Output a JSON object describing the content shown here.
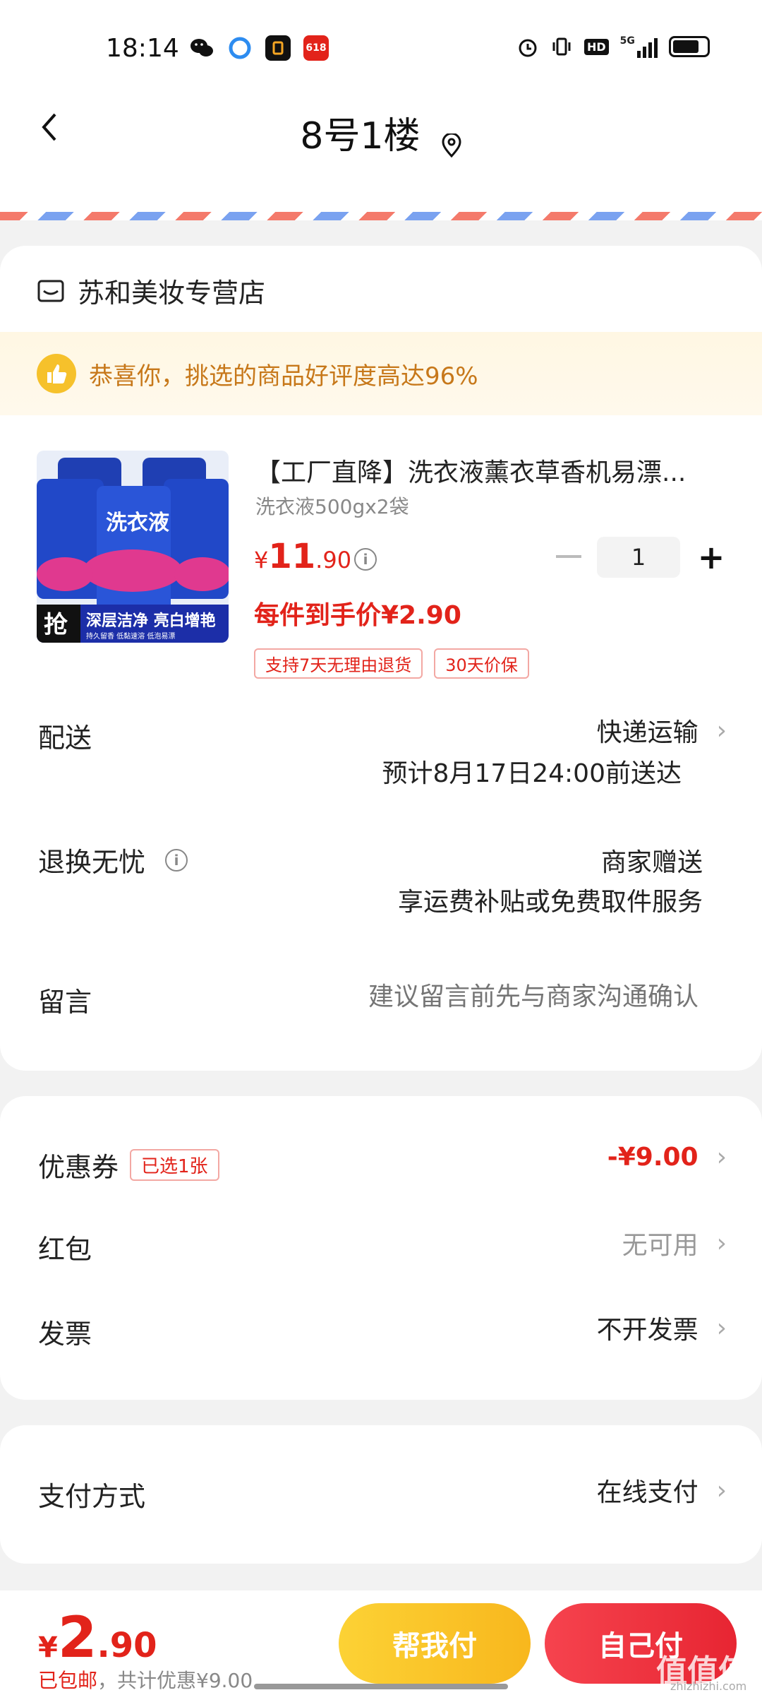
{
  "status_bar": {
    "time": "18:14",
    "app_icons": [
      "wechat-icon",
      "browser-icon",
      "app-icon",
      "618-icon"
    ],
    "badge_618": "618",
    "network": "5G",
    "hd": "HD"
  },
  "header": {
    "title": "8号1楼"
  },
  "store": {
    "name": "苏和美妆专营店"
  },
  "promo": {
    "text": "恭喜你，挑选的商品好评度高达96%"
  },
  "product": {
    "title": "【工厂直降】洗衣液薰衣草香机易漂...",
    "spec": "洗衣液500gx2袋",
    "currency": "¥",
    "price_int": "11",
    "price_dec": ".90",
    "quantity": "1",
    "deal_price": "每件到手价¥2.90",
    "tags": [
      "支持7天无理由退货",
      "30天价保"
    ],
    "image_text": {
      "brand": "洗衣液",
      "grab": "抢",
      "slogan": "深层洁净 亮白增艳",
      "small": "持久留香  低黏速溶  低泡易漂"
    }
  },
  "delivery": {
    "label": "配送",
    "method": "快递运输",
    "eta": "预计8月17日24:00前送达"
  },
  "returns": {
    "label": "退换无忧",
    "value": "商家赠送",
    "desc": "享运费补贴或免费取件服务"
  },
  "message": {
    "label": "留言",
    "placeholder": "建议留言前先与商家沟通确认"
  },
  "coupon": {
    "label": "优惠券",
    "badge": "已选1张",
    "value": "-¥9.00"
  },
  "red_packet": {
    "label": "红包",
    "value": "无可用"
  },
  "invoice": {
    "label": "发票",
    "value": "不开发票"
  },
  "payment": {
    "label": "支付方式",
    "value": "在线支付"
  },
  "bottom": {
    "currency": "¥",
    "total_int": "2",
    "total_dec": ".90",
    "free_shipping": "已包邮",
    "discount_text": "，共计优惠¥9.00",
    "help_pay": "帮我付",
    "self_pay": "自己付",
    "watermark": "值值值",
    "watermark_sub": "zhizhizhi.com"
  },
  "colors": {
    "accent_red": "#e2231a",
    "promo_orange": "#c7781a",
    "help_pay_yellow": "#fcd235"
  }
}
